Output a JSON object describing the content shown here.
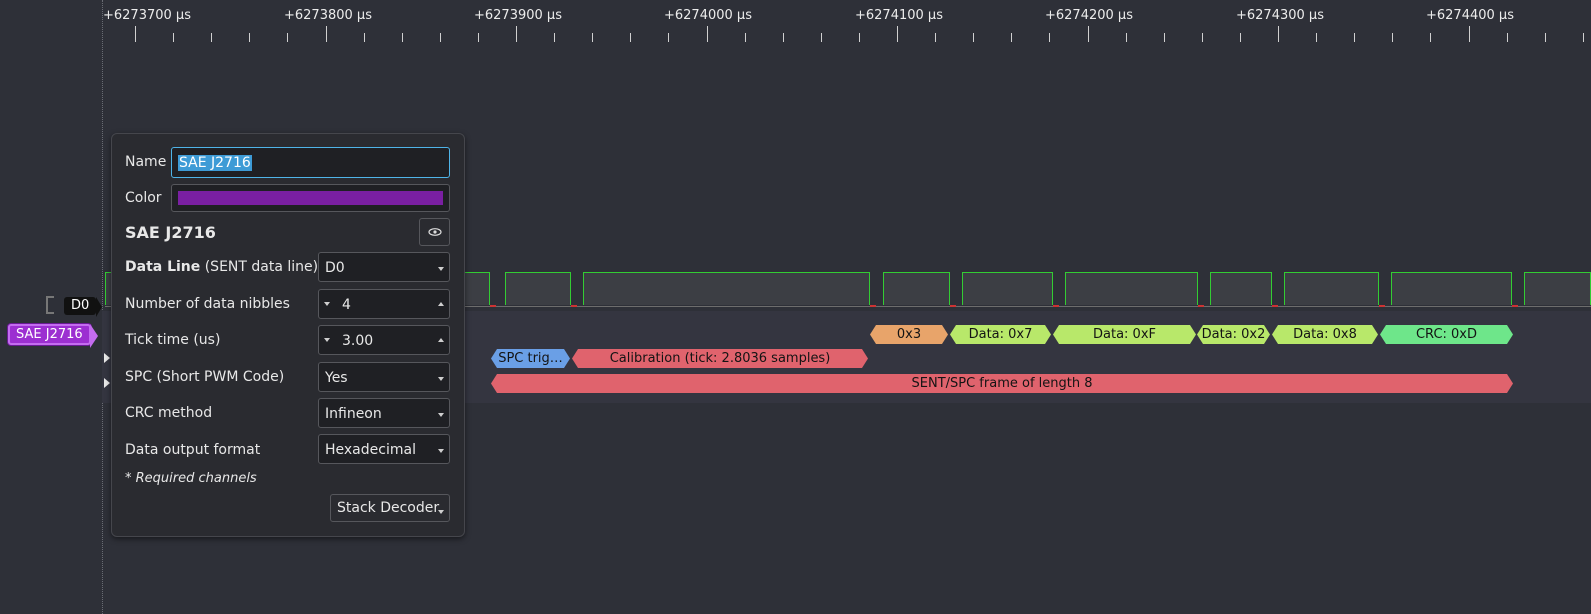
{
  "ruler": {
    "labels": [
      "+6273700 µs",
      "+6273800 µs",
      "+6273900 µs",
      "+6274000 µs",
      "+6274100 µs",
      "+6274200 µs",
      "+6274300 µs",
      "+6274400 µs"
    ]
  },
  "channels": {
    "d0_label": "D0",
    "decoder_label": "SAE J2716"
  },
  "annotations": {
    "row1": [
      "0x3",
      "Data: 0x7",
      "Data: 0xF",
      "Data: 0x2",
      "Data: 0x8",
      "CRC: 0xD"
    ],
    "spc_trigger": "SPC trig…",
    "calibration": "Calibration (tick: 2.8036 samples)",
    "frame": "SENT/SPC frame of length 8"
  },
  "popup": {
    "name_label": "Name",
    "name_value": "SAE J2716",
    "color_label": "Color",
    "color_value": "#7a1fa2",
    "decoder_title": "SAE J2716",
    "data_line_label_bold": "Data Line",
    "data_line_label_rest": " (SENT data line) *",
    "data_line_value": "D0",
    "nibbles_label": "Number of data nibbles",
    "nibbles_value": "4",
    "tick_label": "Tick time (us)",
    "tick_value": "3.00",
    "spc_label": "SPC (Short PWM Code)",
    "spc_value": "Yes",
    "crc_label": "CRC method",
    "crc_value": "Infineon",
    "format_label": "Data output format",
    "format_value": "Hexadecimal",
    "required_note": "* Required channels",
    "stack_button": "Stack Decoder"
  },
  "colors": {
    "annotation_orange": "#e8a46a",
    "annotation_green": "#b8e86a",
    "annotation_crc": "#6ee68a",
    "annotation_blue": "#6a9fe6",
    "annotation_red": "#e0636d",
    "trace_green": "#33cc33"
  }
}
